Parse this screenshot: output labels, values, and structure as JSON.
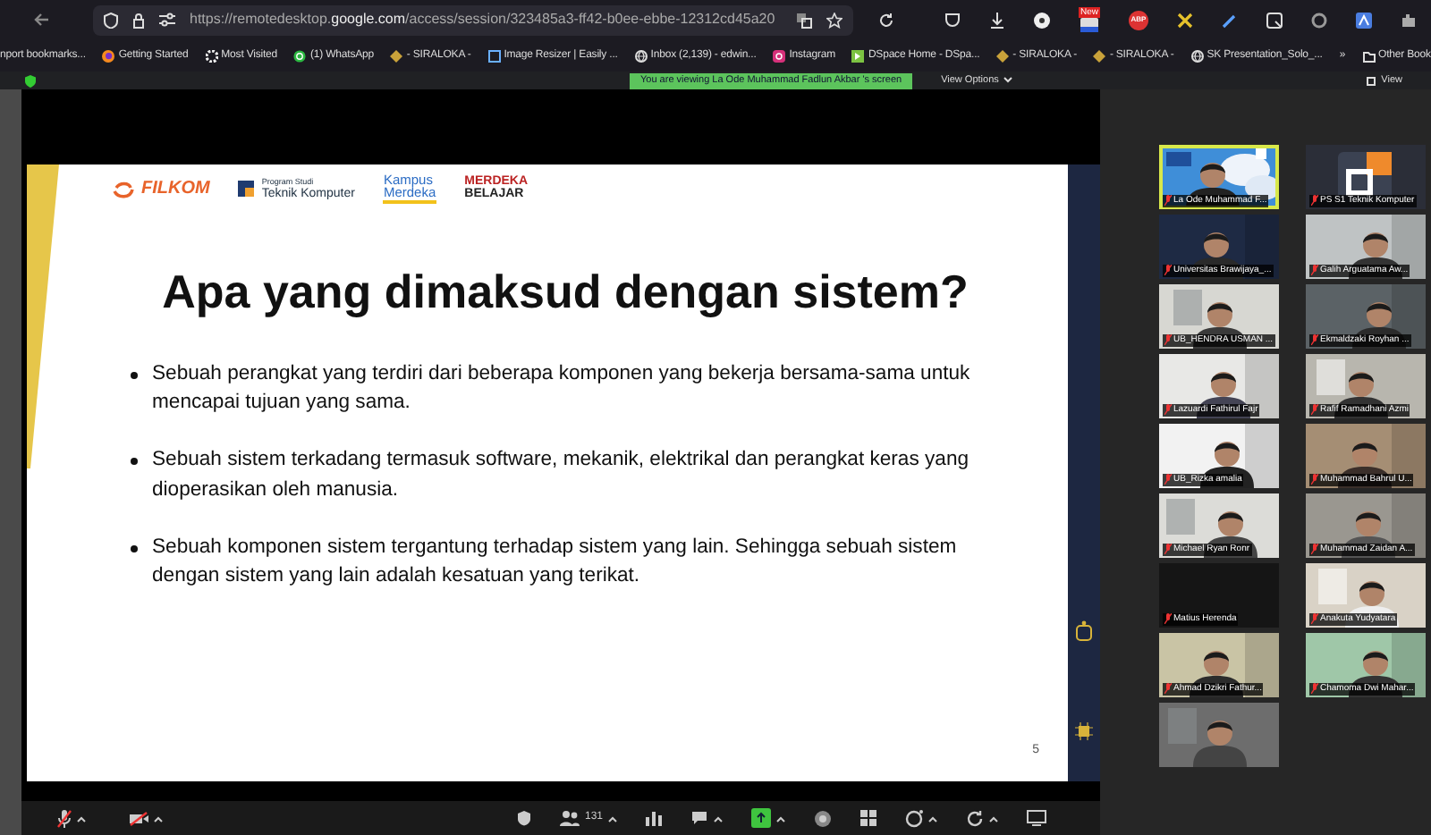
{
  "browser": {
    "url": "https://remotedesktop.**google.com**/access/session/323485a3-ff42-b0ee-ebbe-12312cd45a20",
    "badge": "New",
    "adblock": "ABP"
  },
  "bookmarks": [
    {
      "label": "nport bookmarks...",
      "kind": "plain"
    },
    {
      "label": "Getting Started",
      "kind": "firefox"
    },
    {
      "label": "Most Visited",
      "kind": "gear"
    },
    {
      "label": "(1) WhatsApp",
      "kind": "whatsapp"
    },
    {
      "label": "- SIRALOKA -",
      "kind": "siraloka"
    },
    {
      "label": "Image Resizer | Easily ...",
      "kind": "resizer"
    },
    {
      "label": "Inbox (2,139) - edwin...",
      "kind": "globe"
    },
    {
      "label": "Instagram",
      "kind": "instagram"
    },
    {
      "label": "DSpace Home - DSpa...",
      "kind": "dspace"
    },
    {
      "label": "- SIRALOKA -",
      "kind": "siraloka"
    },
    {
      "label": "- SIRALOKA -",
      "kind": "siraloka"
    },
    {
      "label": "SK Presentation_Solo_...",
      "kind": "globe"
    },
    {
      "label": "»",
      "kind": "plain"
    },
    {
      "label": "Other Book",
      "kind": "folder"
    }
  ],
  "remote_bar": {
    "banner": "You are viewing La Ode Muhammad Fadlun Akbar 's screen",
    "view_options": "View Options",
    "view": "View"
  },
  "slide": {
    "filkom": "FILKOM",
    "program_line1": "Program Studi",
    "program_line2": "Teknik Komputer",
    "kampus_line1": "Kampus",
    "kampus_line2": "Merdeka",
    "merdeka_line1": "MERDEKA",
    "merdeka_line2": "BELAJAR",
    "title": "Apa yang dimaksud dengan sistem?",
    "bullets": [
      "Sebuah perangkat yang terdiri dari beberapa komponen  yang bekerja bersama-sama untuk mencapai tujuan yang  sama.",
      "Sebuah sistem terkadang termasuk software, mekanik,  elektrikal dan perangkat keras yang dioperasikan oleh  manusia.",
      "Sebuah komponen sistem tergantung terhadap sistem  yang lain. Sehingga sebuah sistem dengan sistem yang  lain adalah kesatuan yang terikat."
    ],
    "page": "5"
  },
  "participants": [
    {
      "name": "La Ode Muhammad F...",
      "muted": true,
      "speaking": true,
      "kind": "person"
    },
    {
      "name": "PS S1 Teknik Komputer",
      "muted": true,
      "speaking": false,
      "kind": "logo"
    },
    {
      "name": "Universitas Brawijaya_...",
      "muted": true,
      "speaking": false,
      "kind": "person"
    },
    {
      "name": "Galih Arguatama Aw...",
      "muted": true,
      "speaking": false,
      "kind": "person"
    },
    {
      "name": "UB_HENDRA USMAN ...",
      "muted": true,
      "speaking": false,
      "kind": "person"
    },
    {
      "name": "Ekmaldzaki Royhan ...",
      "muted": true,
      "speaking": false,
      "kind": "person"
    },
    {
      "name": "Lazuardi Fathirul Fajr",
      "muted": true,
      "speaking": false,
      "kind": "person"
    },
    {
      "name": "Rafif Ramadhani Azmi",
      "muted": true,
      "speaking": false,
      "kind": "person"
    },
    {
      "name": "UB_Rizka amalia",
      "muted": true,
      "speaking": false,
      "kind": "person"
    },
    {
      "name": "Muhammad Bahrul U...",
      "muted": true,
      "speaking": false,
      "kind": "person"
    },
    {
      "name": "Michael Ryan Ronr",
      "muted": true,
      "speaking": false,
      "kind": "person"
    },
    {
      "name": "Muhammad Zaidan A...",
      "muted": true,
      "speaking": false,
      "kind": "person"
    },
    {
      "name": "Matius Herenda",
      "muted": true,
      "speaking": false,
      "kind": "off"
    },
    {
      "name": "Anakuta Yudyatara",
      "muted": true,
      "speaking": false,
      "kind": "person"
    },
    {
      "name": "Ahmad Dzikri Fathur...",
      "muted": true,
      "speaking": false,
      "kind": "person"
    },
    {
      "name": "Chamoma Dwi Mahar...",
      "muted": true,
      "speaking": false,
      "kind": "person"
    },
    {
      "kind": "person"
    }
  ],
  "toolbar": {
    "mic_muted": true,
    "video_off": true,
    "participants_count": "131",
    "sharing": true
  }
}
